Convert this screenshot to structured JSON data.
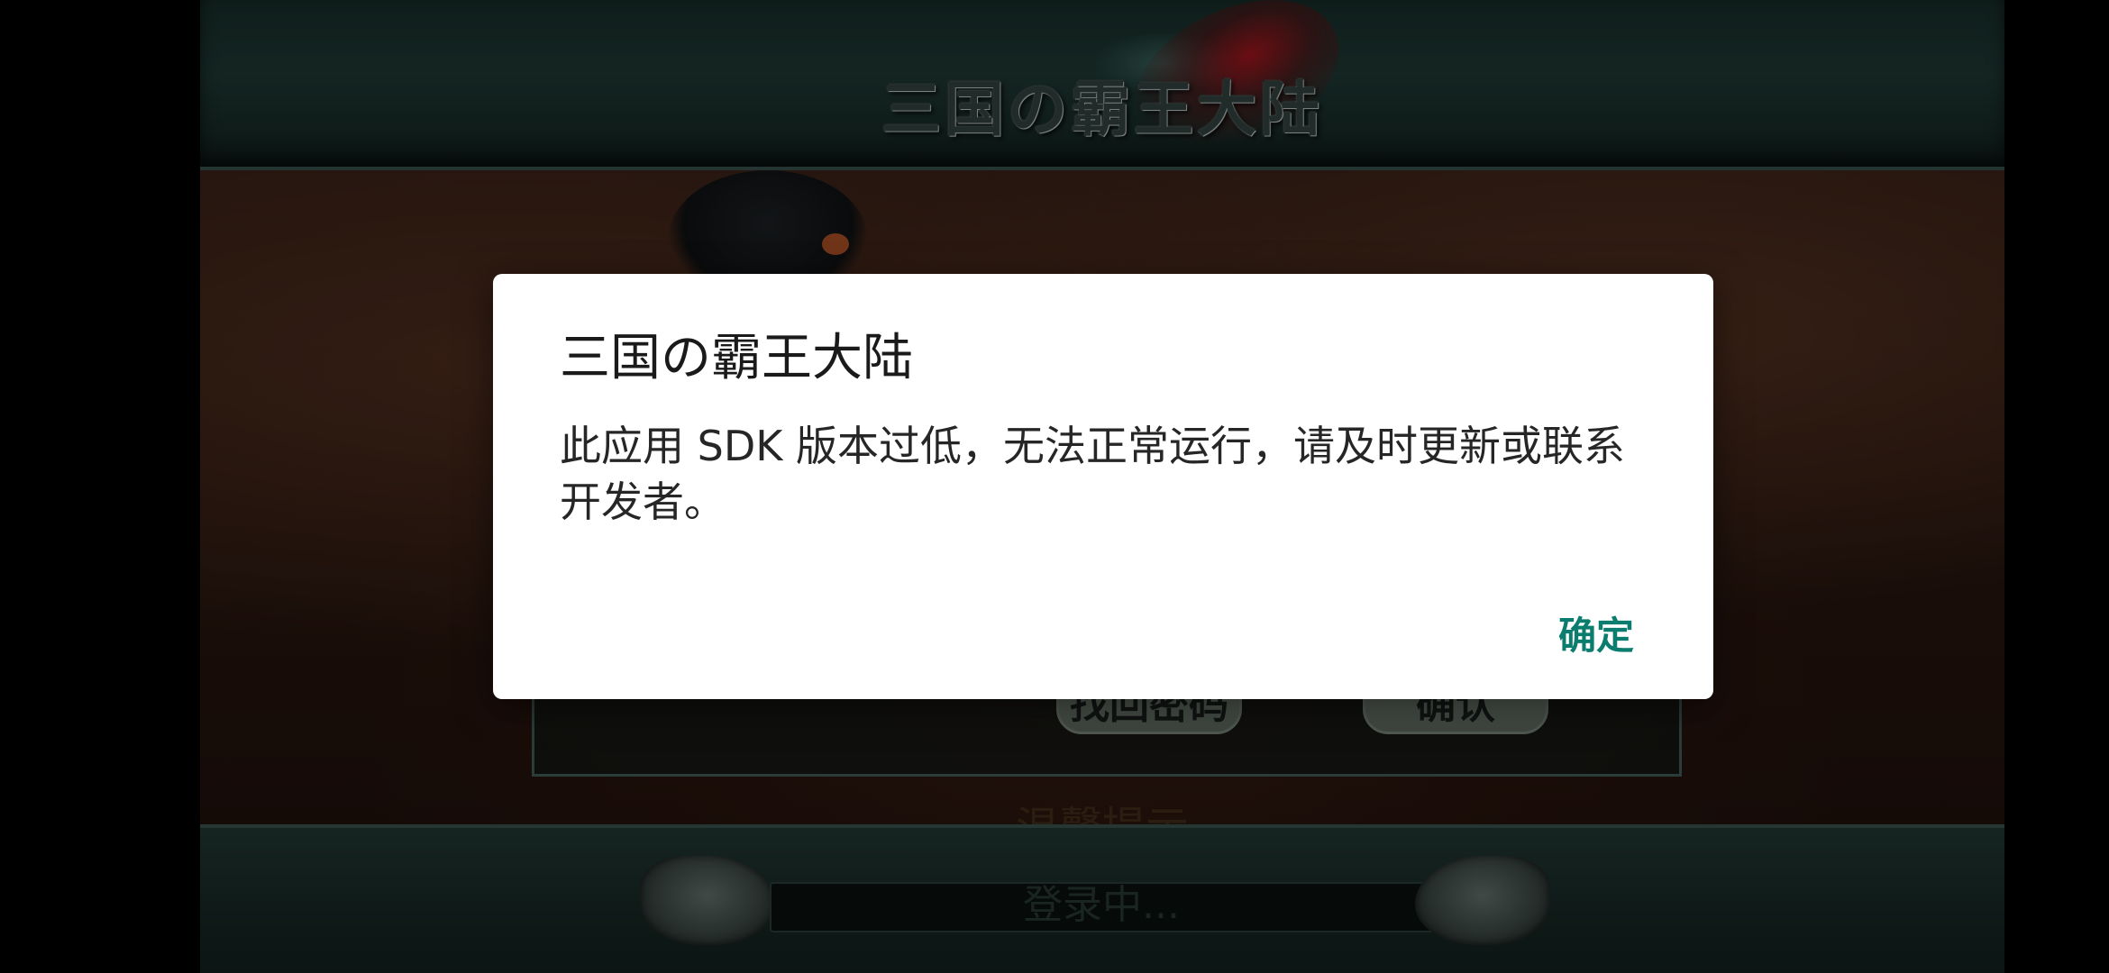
{
  "game": {
    "logo_text": "三国の霸王大陆",
    "bg_button_find": "找回密码",
    "bg_button_confirm": "确认",
    "bg_panel_text": "温馨提示",
    "status_text": "登录中..."
  },
  "dialog": {
    "title": "三国の霸王大陆",
    "message": "此应用 SDK 版本过低，无法正常运行，请及时更新或联系开发者。",
    "ok_label": "确定"
  },
  "colors": {
    "accent": "#0a7d6e",
    "dialog_bg": "#ffffff",
    "scrim": "rgba(0,0,0,0.42)"
  }
}
